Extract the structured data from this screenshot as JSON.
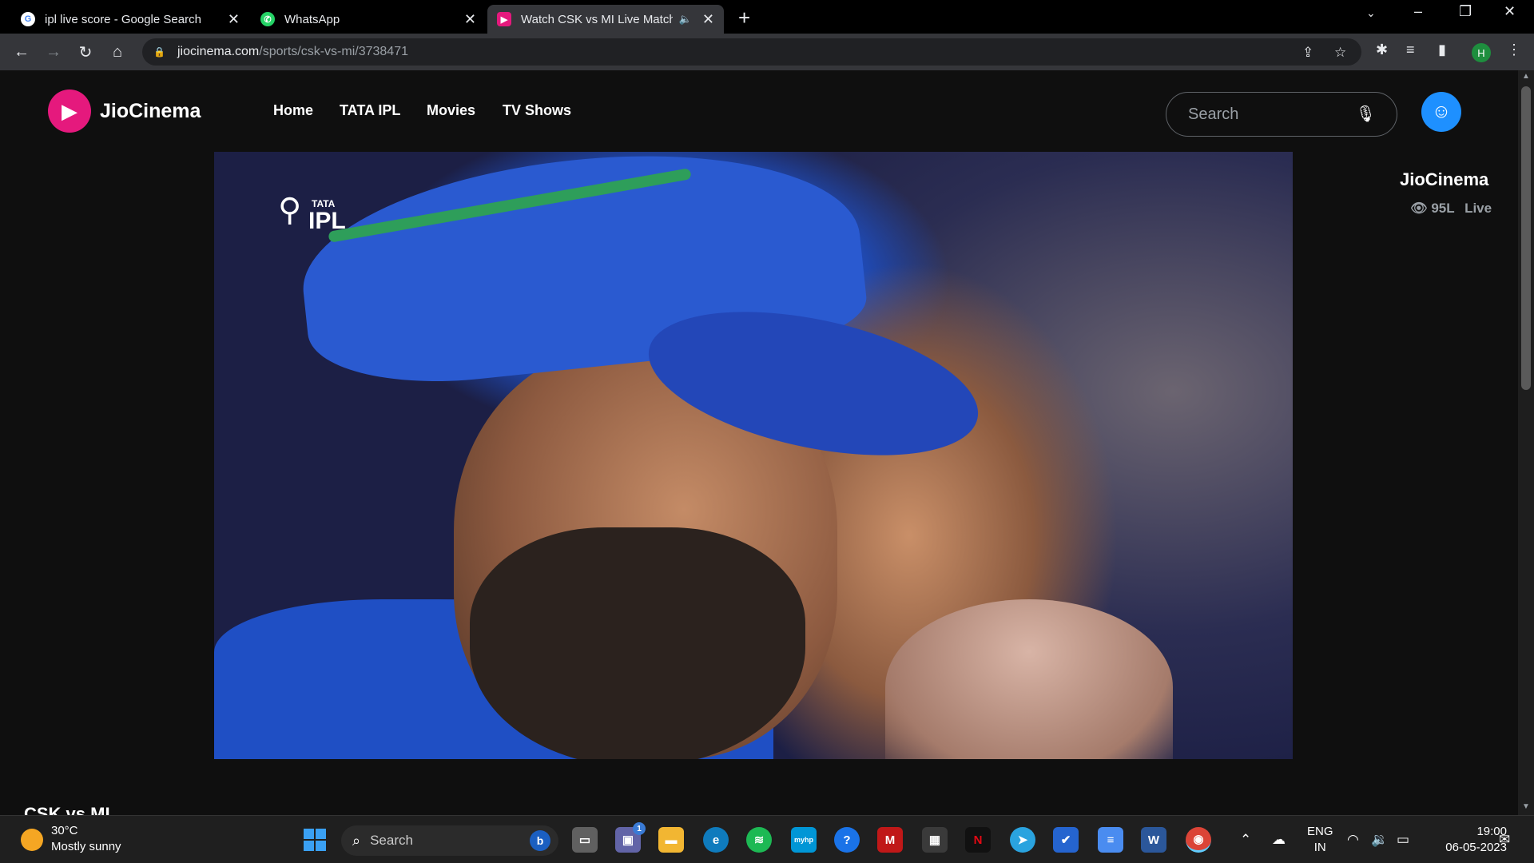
{
  "browser": {
    "tabs": [
      {
        "title": "ipl live score - Google Search",
        "favicon": "google-icon"
      },
      {
        "title": "WhatsApp",
        "favicon": "whatsapp-icon"
      },
      {
        "title": "Watch CSK vs MI Live Match",
        "favicon": "jiocinema-icon",
        "active": true,
        "audio": true
      }
    ],
    "url_host": "jiocinema.com",
    "url_path": "/sports/csk-vs-mi/3738471",
    "profile_initial": "H",
    "profile_color": "#1e8e3e"
  },
  "site": {
    "brand": "JioCinema",
    "brand_color": "#e5197d",
    "nav": [
      "Home",
      "TATA IPL",
      "Movies",
      "TV Shows"
    ],
    "search_placeholder": "Search",
    "video_logo_brand": "TATA",
    "video_logo_text": "IPL",
    "channel": "JioCinema",
    "views": "95L",
    "live_label": "Live",
    "match_title_peek": "CSK vs MI"
  },
  "taskbar": {
    "weather_temp": "30°C",
    "weather_desc": "Mostly sunny",
    "search_placeholder": "Search",
    "bing_letter": "b",
    "teams_badge": "1",
    "language": "ENG",
    "region": "IN",
    "time": "19:00",
    "date": "06-05-2023",
    "apps": [
      "file-explorer-icon",
      "teams-icon",
      "folder-icon",
      "edge-icon",
      "spotify-icon",
      "myhp-icon",
      "help-icon",
      "mcafee-icon",
      "store-icon",
      "netflix-icon",
      "telegram-icon",
      "todo-icon",
      "notepad-icon",
      "word-icon",
      "chrome-icon"
    ],
    "myhp_label": "myhp",
    "netflix_letter": "N",
    "word_letter": "W"
  }
}
